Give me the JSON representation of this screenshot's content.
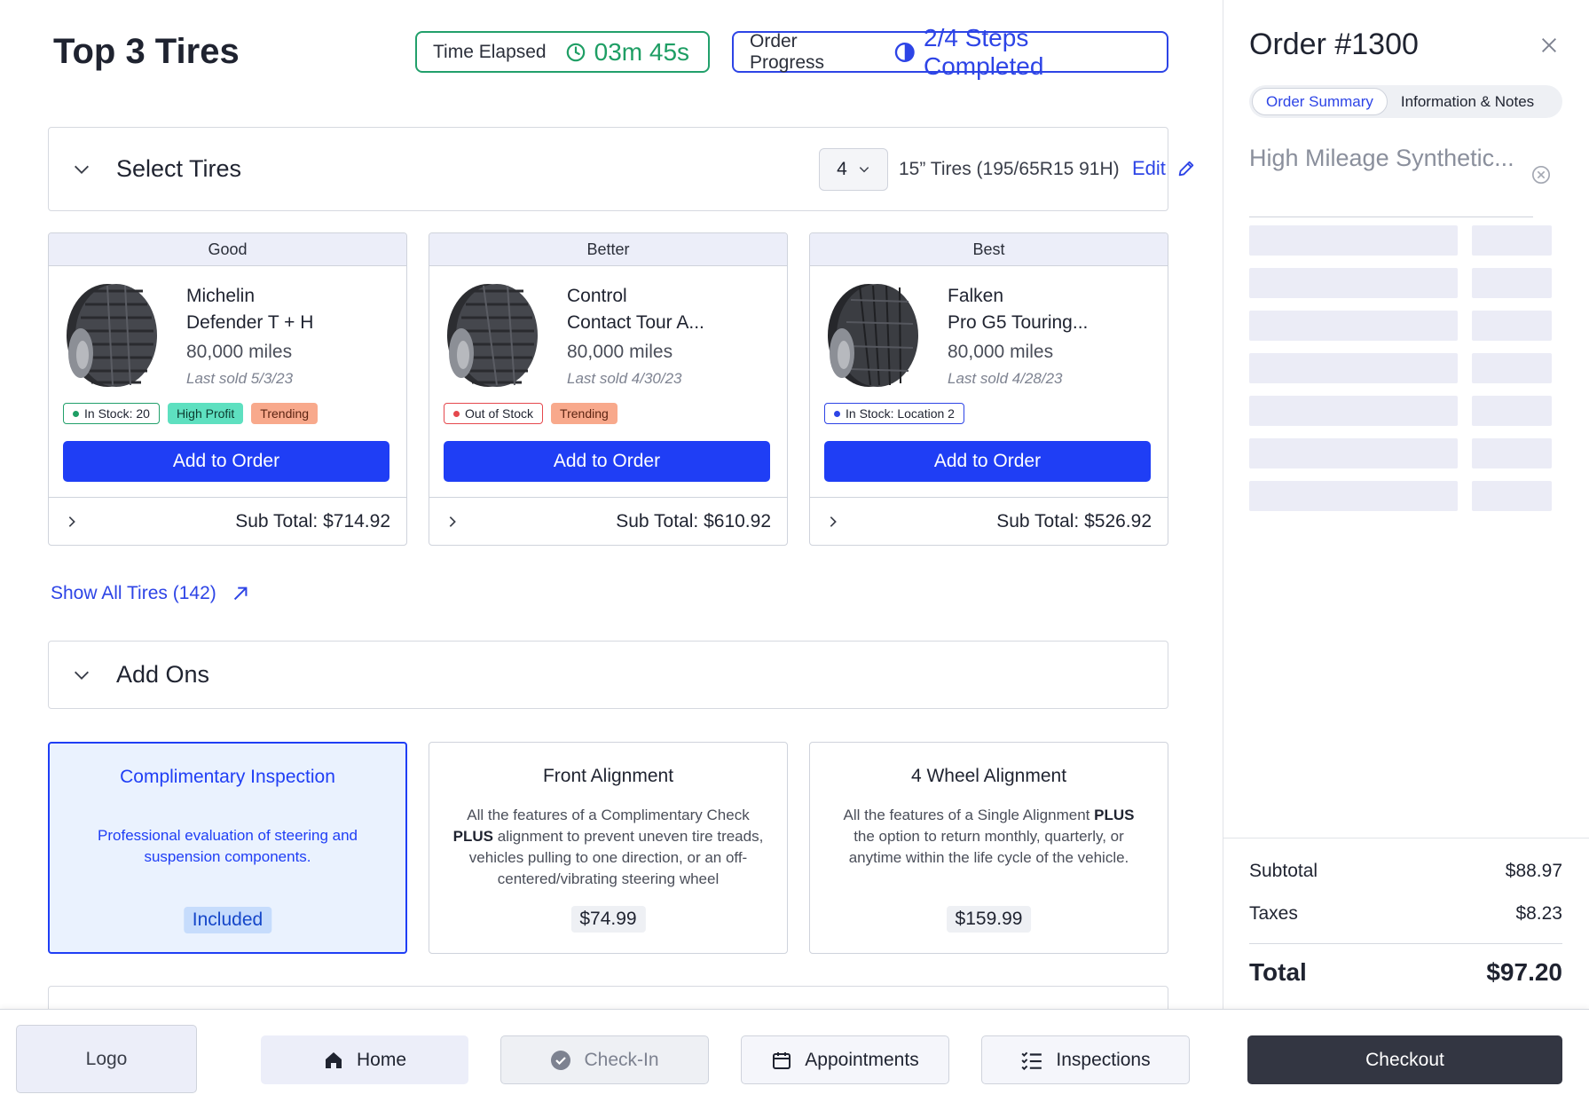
{
  "header": {
    "title": "Top 3 Tires",
    "time_label": "Time Elapsed",
    "time_value": "03m 45s",
    "progress_label": "Order Progress",
    "progress_value": "2/4 Steps Completed",
    "progress_fraction": 0.5
  },
  "tires_section": {
    "title": "Select Tires",
    "quantity": "4",
    "tire_size": "15” Tires (195/65R15 91H)",
    "edit_label": "Edit"
  },
  "tires": [
    {
      "tier": "Good",
      "brand": "Michelin",
      "model": "Defender T + H",
      "miles": "80,000 miles",
      "last_sold": "Last sold 5/3/23",
      "badges": {
        "stock": "In Stock: 20",
        "profit": "High Profit",
        "trending": "Trending"
      },
      "add_label": "Add to Order",
      "subtotal": "Sub Total: $714.92"
    },
    {
      "tier": "Better",
      "brand": "Control",
      "model": "Contact Tour A...",
      "miles": "80,000 miles",
      "last_sold": "Last sold 4/30/23",
      "badges": {
        "stock": "Out of Stock",
        "trending": "Trending"
      },
      "add_label": "Add to Order",
      "subtotal": "Sub Total: $610.92"
    },
    {
      "tier": "Best",
      "brand": "Falken",
      "model": "Pro G5 Touring...",
      "miles": "80,000 miles",
      "last_sold": "Last sold 4/28/23",
      "badges": {
        "stock": "In Stock: Location 2"
      },
      "add_label": "Add to Order",
      "subtotal": "Sub Total: $526.92"
    }
  ],
  "show_all": "Show All Tires (142)",
  "addons_section": {
    "title": "Add Ons"
  },
  "addons": [
    {
      "title": "Complimentary Inspection",
      "desc": "Professional evaluation of steering and suspension components.",
      "price": "Included"
    },
    {
      "title": "Front Alignment",
      "desc_prefix": "All the features of a Complimentary Check",
      "desc_bold": "PLUS",
      "desc_rest": "alignment to prevent uneven tire treads, vehicles pulling to one direction, or an off-centered/vibrating steering wheel",
      "price": "$74.99"
    },
    {
      "title": "4 Wheel Alignment",
      "desc_prefix": "All the features of a Single Alignment",
      "desc_bold": "PLUS",
      "desc_rest": "the option to return monthly, quarterly, or anytime within the life cycle of the vehicle.",
      "price": "$159.99"
    }
  ],
  "panel": {
    "order_title": "Order #1300",
    "tabs": [
      "Order Summary",
      "Information & Notes"
    ],
    "active_tab": "Order Summary",
    "search_value": "High Mileage Synthetic...",
    "subtotal_label": "Subtotal",
    "subtotal_value": "$88.97",
    "taxes_label": "Taxes",
    "taxes_value": "$8.23",
    "total_label": "Total",
    "total_value": "$97.20"
  },
  "nav": {
    "logo": "Logo",
    "home": "Home",
    "checkin": "Check-In",
    "appointments": "Appointments",
    "inspections": "Inspections",
    "checkout": "Checkout"
  },
  "colors": {
    "primary": "#1f3ef5",
    "success": "#1e9e64",
    "danger": "#e5484d",
    "dark_button": "#333642"
  },
  "icons": [
    "clock-icon",
    "half-circle-progress-icon",
    "chevron-down-icon",
    "pencil-icon",
    "chevron-right-icon",
    "arrow-up-right-icon",
    "close-icon",
    "clear-icon",
    "home-icon",
    "check-circle-icon",
    "calendar-icon",
    "checklist-icon"
  ]
}
